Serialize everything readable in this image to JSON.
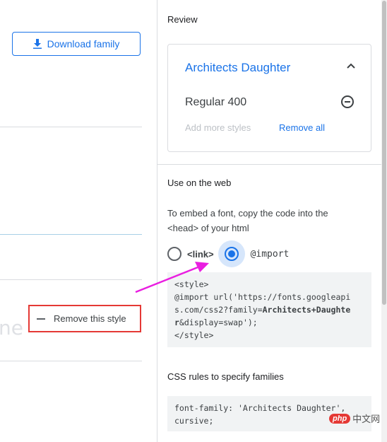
{
  "left": {
    "download_button": "Download family",
    "remove_style_button": "Remove this style",
    "partial_glyph": "ne"
  },
  "panel": {
    "review_title": "Review",
    "family_name": "Architects Daughter",
    "style_name": "Regular 400",
    "add_more": "Add more styles",
    "remove_all": "Remove all",
    "web_title": "Use on the web",
    "embed_text": "To embed a font, copy the code into the <head> of your html",
    "radio_link": "<link>",
    "radio_import": "@import",
    "import_selected": true,
    "code_import_line1": "<style>",
    "code_import_line2": "@import url('https://fonts.googleapis.com/css2?family=",
    "code_import_bold": "Architects+Daughter",
    "code_import_line3": "&display=swap');",
    "code_import_line4": "</style>",
    "css_rules_title": "CSS rules to specify families",
    "css_rule": "font-family: 'Architects Daughter', cursive;"
  },
  "watermark": {
    "badge": "php",
    "text": "中文网"
  },
  "colors": {
    "accent": "#1a73e8",
    "highlight_box": "#e53935",
    "arrow": "#e91ee0"
  }
}
